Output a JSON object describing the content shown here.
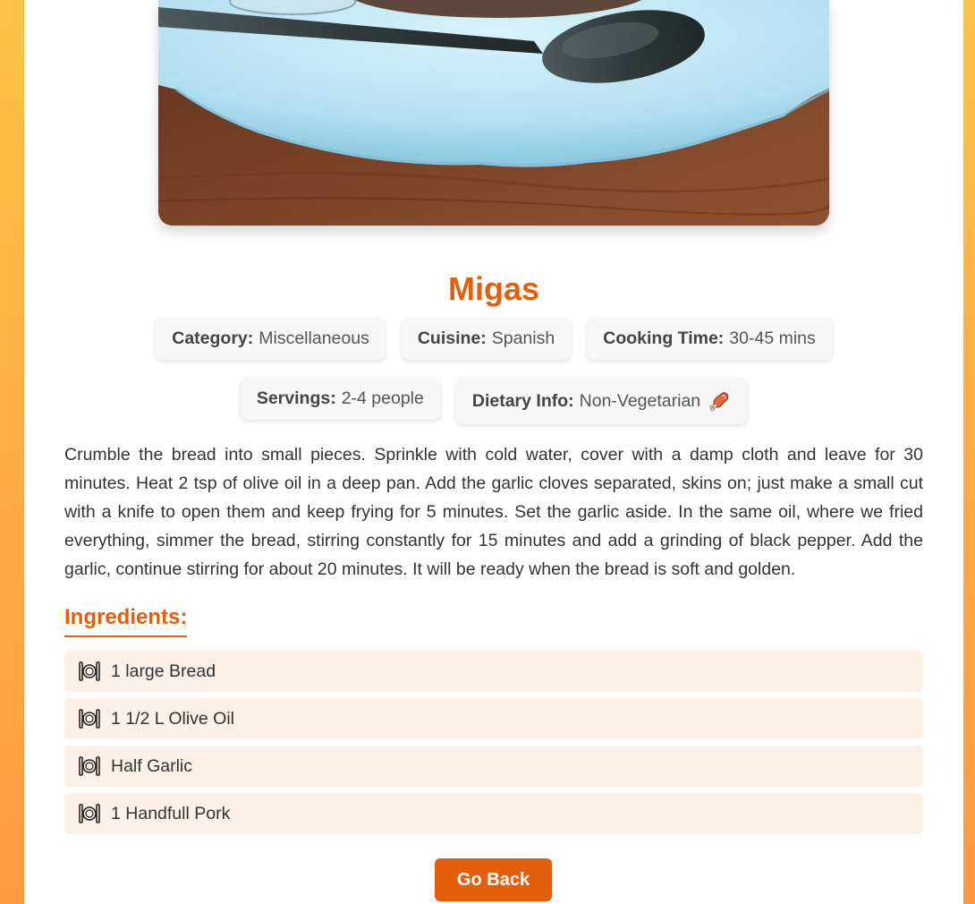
{
  "recipe": {
    "title": "Migas",
    "meta": [
      {
        "label": "Category:",
        "value": "Miscellaneous"
      },
      {
        "label": "Cuisine:",
        "value": "Spanish"
      },
      {
        "label": "Cooking Time:",
        "value": "30-45 mins"
      },
      {
        "label": "Servings:",
        "value": "2-4 people"
      },
      {
        "label": "Dietary Info:",
        "value": "Non-Vegetarian",
        "icon": "meat-icon"
      }
    ],
    "description": "Crumble the bread into small pieces. Sprinkle with cold water, cover with a damp cloth and leave for 30 minutes. Heat 2 tsp of olive oil in a deep pan. Add the garlic cloves separated, skins on; just make a small cut with a knife to open them and keep frying for 5 minutes. Set the garlic aside. In the same oil, where we fried everything, simmer the bread, stirring constantly for 15 minutes and add a grinding of black pepper. Add the garlic, continue stirring for about 20 minutes. It will be ready when the bread is soft and golden.",
    "ingredients_heading": "Ingredients:",
    "ingredients": [
      {
        "text": "1 large Bread",
        "icon": "plate-cutlery-icon"
      },
      {
        "text": "1 1/2 L Olive Oil",
        "icon": "plate-cutlery-icon"
      },
      {
        "text": "Half Garlic",
        "icon": "plate-cutlery-icon"
      },
      {
        "text": "1 Handfull Pork",
        "icon": "plate-cutlery-icon"
      }
    ],
    "back_label": "Go Back"
  },
  "colors": {
    "accent": "#e35f0c",
    "ingredient_bg": "#fcf0e7",
    "badge_bg": "#f8f8f8",
    "page_gradient_top": "#fcc245",
    "page_gradient_bottom": "#fd9a40"
  }
}
